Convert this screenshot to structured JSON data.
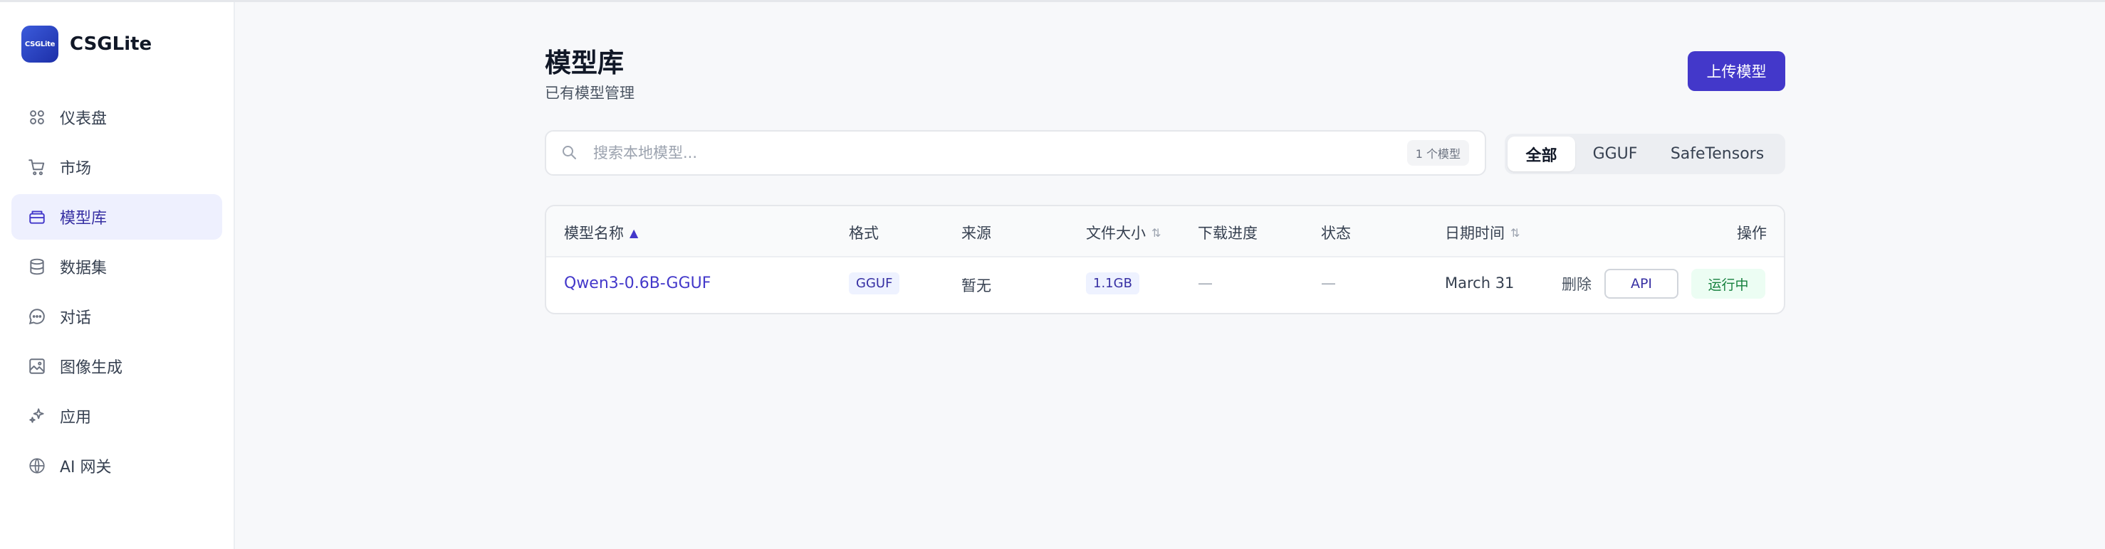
{
  "brand": {
    "logo_text": "CSGLite",
    "name": "CSGLite"
  },
  "sidebar": {
    "items": [
      {
        "label": "仪表盘",
        "icon": "grid-icon"
      },
      {
        "label": "市场",
        "icon": "cart-icon"
      },
      {
        "label": "模型库",
        "icon": "box-icon",
        "active": true
      },
      {
        "label": "数据集",
        "icon": "database-icon"
      },
      {
        "label": "对话",
        "icon": "chat-icon"
      },
      {
        "label": "图像生成",
        "icon": "image-icon"
      },
      {
        "label": "应用",
        "icon": "sparkles-icon"
      },
      {
        "label": "AI 网关",
        "icon": "ai-gateway-icon"
      }
    ]
  },
  "header": {
    "title": "模型库",
    "subtitle": "已有模型管理",
    "upload_label": "上传模型"
  },
  "search": {
    "placeholder": "搜索本地模型...",
    "value": "",
    "count": "1 个模型"
  },
  "filters": {
    "tabs": [
      "全部",
      "GGUF",
      "SafeTensors"
    ],
    "selected": "全部"
  },
  "table": {
    "columns": [
      "模型名称",
      "格式",
      "来源",
      "文件大小",
      "下载进度",
      "状态",
      "日期时间",
      "操作"
    ],
    "rows": [
      {
        "name": "Qwen3-0.6B-GGUF",
        "format": "GGUF",
        "source": "暂无",
        "size": "1.1GB",
        "progress": "—",
        "status": "—",
        "date": "March 31",
        "delete_label": "删除",
        "api_label": "API",
        "run_status": "运行中"
      }
    ]
  },
  "colors": {
    "accent": "#4338ca",
    "active_nav_bg": "#eef0fe",
    "running_green": "#15803d"
  }
}
